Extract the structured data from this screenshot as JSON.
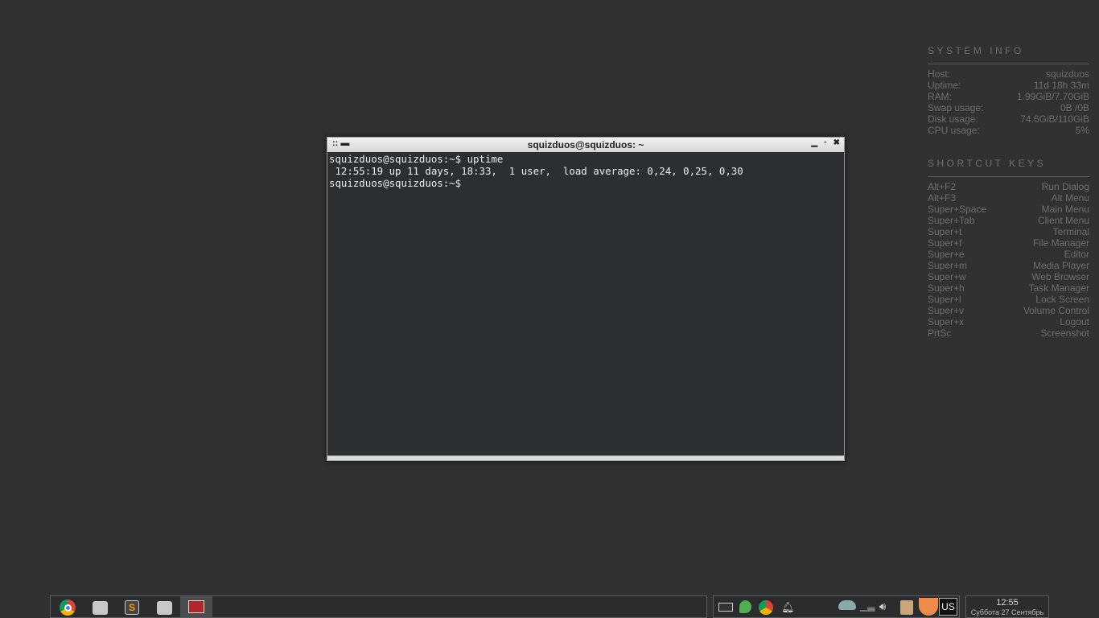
{
  "system_info": {
    "title": "SYSTEM INFO",
    "rows": [
      {
        "label": "Host:",
        "value": "squizduos"
      },
      {
        "label": "Uptime:",
        "value": "11d 18h 33m"
      },
      {
        "label": "RAM:",
        "value": "1.99GiB/7.70GiB"
      },
      {
        "label": "Swap usage:",
        "value": "0B  /0B"
      },
      {
        "label": "Disk usage:",
        "value": "74.6GiB/110GiB"
      },
      {
        "label": "CPU usage:",
        "value": "5%"
      }
    ]
  },
  "shortcuts": {
    "title": "SHORTCUT KEYS",
    "rows": [
      {
        "key": "Alt+F2",
        "action": "Run Dialog"
      },
      {
        "key": "Alt+F3",
        "action": "Alt Menu"
      },
      {
        "key": "Super+Space",
        "action": "Main Menu"
      },
      {
        "key": "Super+Tab",
        "action": "Client Menu"
      },
      {
        "key": "Super+t",
        "action": "Terminal"
      },
      {
        "key": "Super+f",
        "action": "File Manager"
      },
      {
        "key": "Super+e",
        "action": "Editor"
      },
      {
        "key": "Super+m",
        "action": "Media Player"
      },
      {
        "key": "Super+w",
        "action": "Web Browser"
      },
      {
        "key": "Super+h",
        "action": "Task Manager"
      },
      {
        "key": "Super+l",
        "action": "Lock Screen"
      },
      {
        "key": "Super+v",
        "action": "Volume Control"
      },
      {
        "key": "Super+x",
        "action": "Logout"
      },
      {
        "key": "PrtSc",
        "action": "Screenshot"
      }
    ]
  },
  "terminal": {
    "title": "squizduos@squizduos: ~",
    "lines": [
      "squizduos@squizduos:~$ uptime",
      " 12:55:19 up 11 days, 18:33,  1 user,  load average: 0,24, 0,25, 0,30",
      "squizduos@squizduos:~$ "
    ]
  },
  "tray": {
    "keyboard_layout": "US"
  },
  "clock": {
    "time": "12:55",
    "date": "Суббота 27 Сентябрь"
  }
}
